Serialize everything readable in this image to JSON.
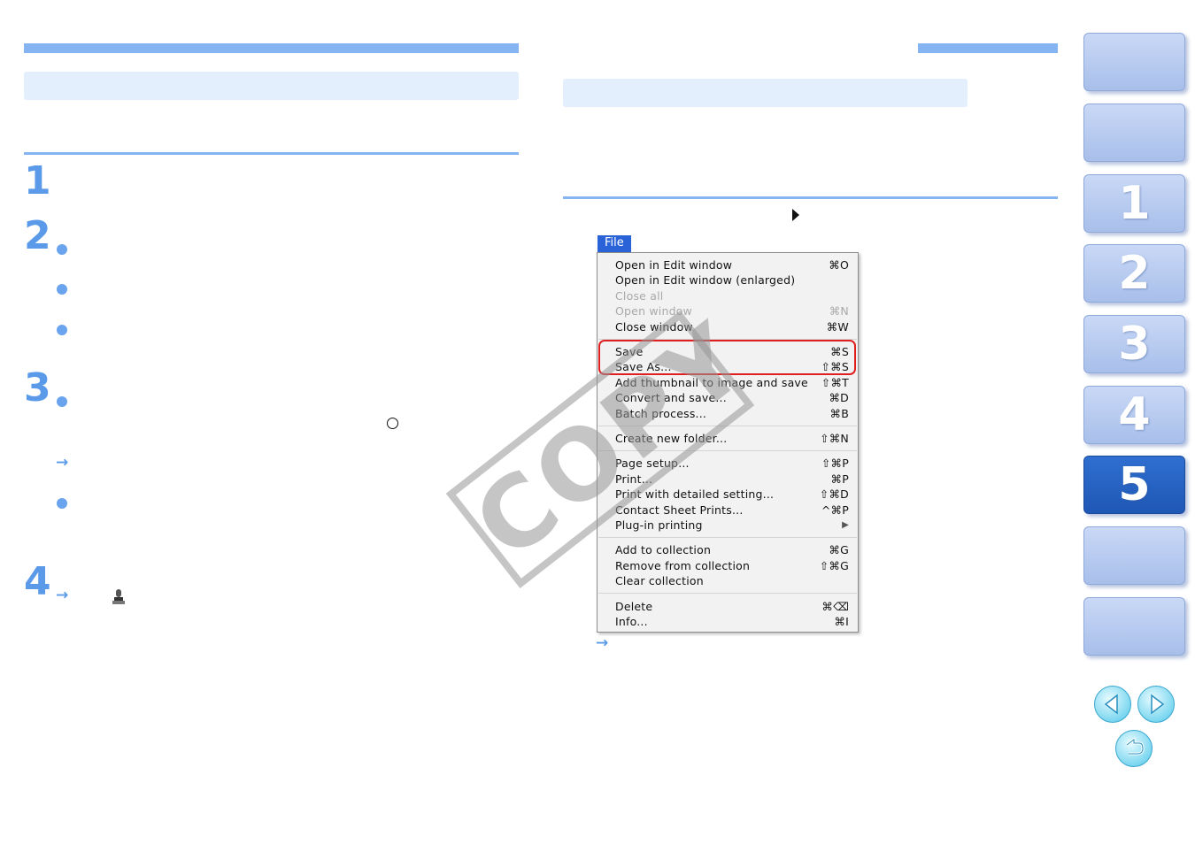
{
  "steps": [
    "1",
    "2",
    "3",
    "4"
  ],
  "menu": {
    "tab_label": "File",
    "items": [
      {
        "label": "Open in Edit window",
        "shortcut": "⌘O",
        "disabled": false
      },
      {
        "label": "Open in Edit window (enlarged)",
        "shortcut": "",
        "disabled": false
      },
      {
        "label": "Close all",
        "shortcut": "",
        "disabled": true
      },
      {
        "label": "Open window",
        "shortcut": "⌘N",
        "disabled": true
      },
      {
        "label": "Close window",
        "shortcut": "⌘W",
        "disabled": false
      },
      {
        "label": "Save",
        "shortcut": "⌘S",
        "disabled": false
      },
      {
        "label": "Save As...",
        "shortcut": "⇧⌘S",
        "disabled": false
      },
      {
        "label": "Add thumbnail to image and save",
        "shortcut": "⇧⌘T",
        "disabled": false
      },
      {
        "label": "Convert and save...",
        "shortcut": "⌘D",
        "disabled": false
      },
      {
        "label": "Batch process...",
        "shortcut": "⌘B",
        "disabled": false
      },
      {
        "label": "Create new folder...",
        "shortcut": "⇧⌘N",
        "disabled": false
      },
      {
        "label": "Page setup...",
        "shortcut": "⇧⌘P",
        "disabled": false
      },
      {
        "label": "Print...",
        "shortcut": "⌘P",
        "disabled": false
      },
      {
        "label": "Print with detailed setting...",
        "shortcut": "⇧⌘D",
        "disabled": false
      },
      {
        "label": "Contact Sheet Prints...",
        "shortcut": "^⌘P",
        "disabled": false
      },
      {
        "label": "Plug-in printing",
        "shortcut": "▶",
        "disabled": false
      },
      {
        "label": "Add to collection",
        "shortcut": "⌘G",
        "disabled": false
      },
      {
        "label": "Remove from collection",
        "shortcut": "⇧⌘G",
        "disabled": false
      },
      {
        "label": "Clear collection",
        "shortcut": "",
        "disabled": false
      },
      {
        "label": "Delete",
        "shortcut": "⌘⌫",
        "disabled": false
      },
      {
        "label": "Info...",
        "shortcut": "⌘I",
        "disabled": false
      }
    ]
  },
  "watermark": "COPY",
  "side_tabs": [
    "",
    "",
    "1",
    "2",
    "3",
    "4",
    "5",
    ""
  ],
  "active_tab": "5",
  "nav": {
    "prev_icon": "prev-arrow-icon",
    "next_icon": "next-arrow-icon",
    "return_icon": "return-icon"
  },
  "colors": {
    "accent": "#86b4f3",
    "panel": "#e3effd",
    "menu_tab": "#2a63d8",
    "highlight": "#e02020",
    "tab_active": "#2f6fd0"
  }
}
